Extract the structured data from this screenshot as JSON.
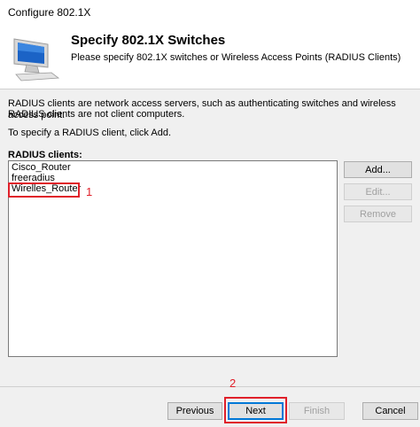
{
  "window": {
    "title": "Configure 802.1X"
  },
  "header": {
    "icon": "computer-monitor-icon",
    "title": "Specify 802.1X Switches",
    "subtitle": "Please specify 802.1X switches or Wireless Access Points (RADIUS Clients)"
  },
  "content": {
    "description_line1": "RADIUS clients are network access servers, such as authenticating switches and wireless access point.",
    "description_line2": "RADIUS clients are not client computers.",
    "instruction": "To specify a RADIUS client, click Add.",
    "list_label": "RADIUS clients:",
    "clients": [
      "Cisco_Router",
      "freeradius",
      "Wirelles_Router"
    ],
    "buttons": {
      "add": "Add...",
      "edit": "Edit...",
      "remove": "Remove"
    }
  },
  "footer": {
    "previous": "Previous",
    "next": "Next",
    "finish": "Finish",
    "cancel": "Cancel"
  },
  "annotations": {
    "marker1": "1",
    "marker2": "2",
    "color": "#e0202a"
  }
}
